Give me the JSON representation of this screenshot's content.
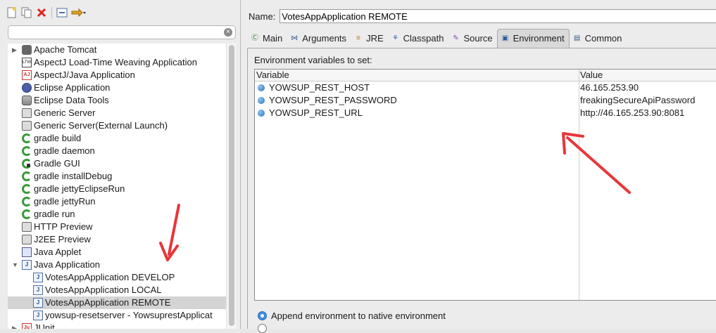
{
  "left_panel": {
    "filter_placeholder": "",
    "tree": [
      {
        "label": "Apache Tomcat",
        "icon": "tomcat-icon",
        "level": 0,
        "expandable": true,
        "expanded": false
      },
      {
        "label": "AspectJ Load-Time Weaving Application",
        "icon": "ltw-icon",
        "level": 0
      },
      {
        "label": "AspectJ/Java Application",
        "icon": "aspectj-icon",
        "level": 0
      },
      {
        "label": "Eclipse Application",
        "icon": "eclipse-icon",
        "level": 0
      },
      {
        "label": "Eclipse Data Tools",
        "icon": "data-tools-icon",
        "level": 0
      },
      {
        "label": "Generic Server",
        "icon": "server-icon",
        "level": 0
      },
      {
        "label": "Generic Server(External Launch)",
        "icon": "server-icon",
        "level": 0
      },
      {
        "label": "gradle build",
        "icon": "gradle-icon",
        "level": 0
      },
      {
        "label": "gradle daemon",
        "icon": "gradle-icon",
        "level": 0
      },
      {
        "label": "Gradle GUI",
        "icon": "gradle-gui-icon",
        "level": 0
      },
      {
        "label": "gradle installDebug",
        "icon": "gradle-icon",
        "level": 0
      },
      {
        "label": "gradle jettyEclipseRun",
        "icon": "gradle-icon",
        "level": 0
      },
      {
        "label": "gradle jettyRun",
        "icon": "gradle-icon",
        "level": 0
      },
      {
        "label": "gradle run",
        "icon": "gradle-icon",
        "level": 0
      },
      {
        "label": "HTTP Preview",
        "icon": "server-icon",
        "level": 0
      },
      {
        "label": "J2EE Preview",
        "icon": "server-icon",
        "level": 0
      },
      {
        "label": "Java Applet",
        "icon": "applet-icon",
        "level": 0
      },
      {
        "label": "Java Application",
        "icon": "java-app-icon",
        "level": 0,
        "expandable": true,
        "expanded": true
      },
      {
        "label": "VotesAppApplication DEVELOP",
        "icon": "java-app-icon",
        "level": 1
      },
      {
        "label": "VotesAppApplication LOCAL",
        "icon": "java-app-icon",
        "level": 1
      },
      {
        "label": "VotesAppApplication REMOTE",
        "icon": "java-app-icon",
        "level": 1,
        "selected": true
      },
      {
        "label": "yowsup-resetserver - YowsuprestApplicat",
        "icon": "java-app-icon",
        "level": 1
      },
      {
        "label": "JUnit",
        "icon": "junit-icon",
        "level": 0,
        "expandable": true,
        "expanded": false
      }
    ]
  },
  "right_panel": {
    "name_label": "Name:",
    "name_value": "VotesAppApplication REMOTE",
    "tabs": [
      {
        "label": "Main",
        "icon": "main-icon"
      },
      {
        "label": "Arguments",
        "icon": "arguments-icon"
      },
      {
        "label": "JRE",
        "icon": "jre-icon"
      },
      {
        "label": "Classpath",
        "icon": "classpath-icon"
      },
      {
        "label": "Source",
        "icon": "source-icon"
      },
      {
        "label": "Environment",
        "icon": "environment-icon",
        "active": true
      },
      {
        "label": "Common",
        "icon": "common-icon"
      }
    ],
    "env_caption": "Environment variables to set:",
    "columns": [
      "Variable",
      "Value"
    ],
    "variables": [
      {
        "name": "YOWSUP_REST_HOST",
        "value": "46.165.253.90"
      },
      {
        "name": "YOWSUP_REST_PASSWORD",
        "value": "freakingSecureApiPassword"
      },
      {
        "name": "YOWSUP_REST_URL",
        "value": "http://46.165.253.90:8081"
      }
    ],
    "radio_append": "Append environment to native environment"
  },
  "colors": {
    "annotation_arrow": "#e8363a",
    "selection": "#d4d4d4",
    "radio_on": "#3d8ce6"
  }
}
